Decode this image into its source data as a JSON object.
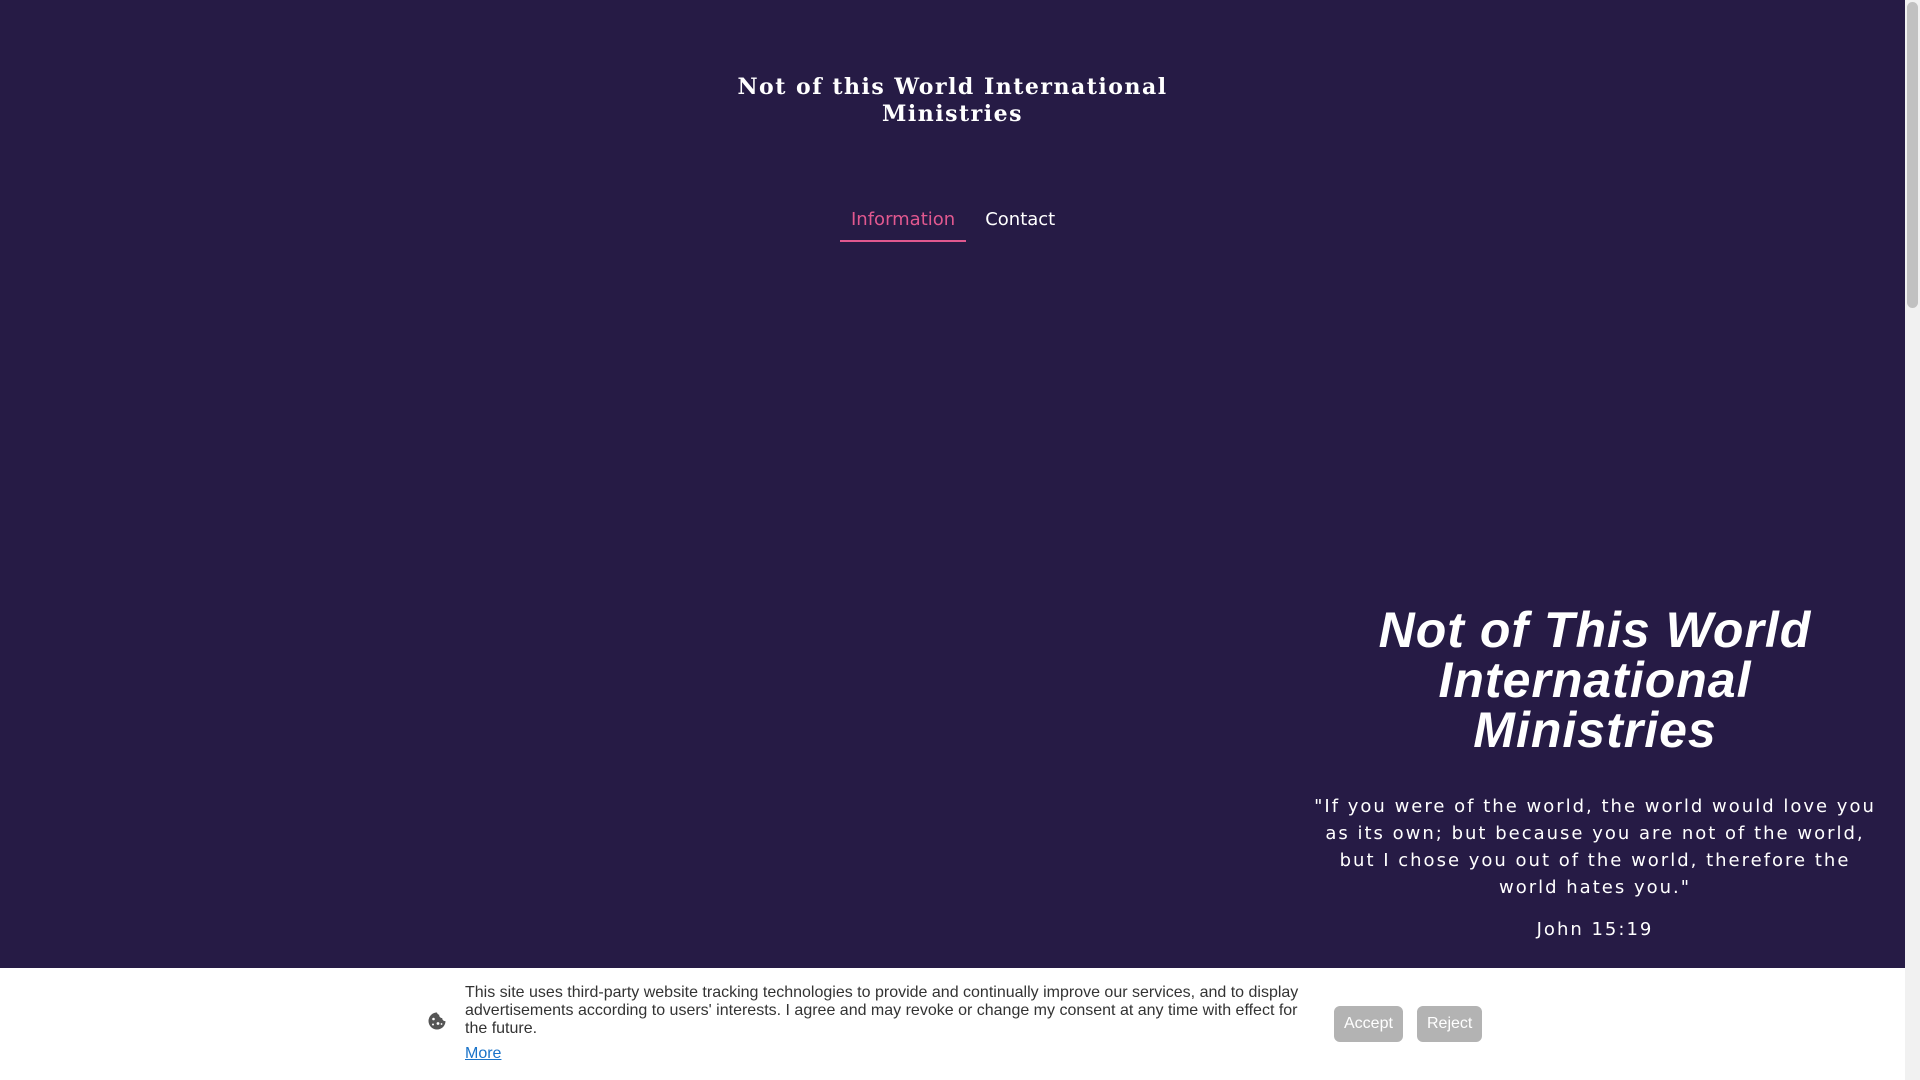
{
  "header": {
    "site_title": "Not of this World International Ministries"
  },
  "nav": {
    "items": [
      {
        "label": "Information",
        "active": true
      },
      {
        "label": "Contact",
        "active": false
      }
    ],
    "accent_color": "#e1588f"
  },
  "hero": {
    "title": "Not of This World International Ministries",
    "quote": "\"If you were of the world, the world would love you as its own; but because you are not of the world, but I chose you out of the world, therefore the world hates you.\"",
    "reference": "John 15:19"
  },
  "cookie_banner": {
    "icon": "cookie-icon",
    "text": "This site uses third-party website tracking technologies to provide and continually improve our services, and to display advertisements according to users' interests. I agree and may revoke or change my consent at any time with effect for the future.",
    "more_label": "More",
    "accept_label": "Accept",
    "reject_label": "Reject"
  },
  "colors": {
    "background": "#261b45",
    "text": "#ffffff",
    "link": "#1a73c9",
    "button": "#b3b3b3"
  }
}
